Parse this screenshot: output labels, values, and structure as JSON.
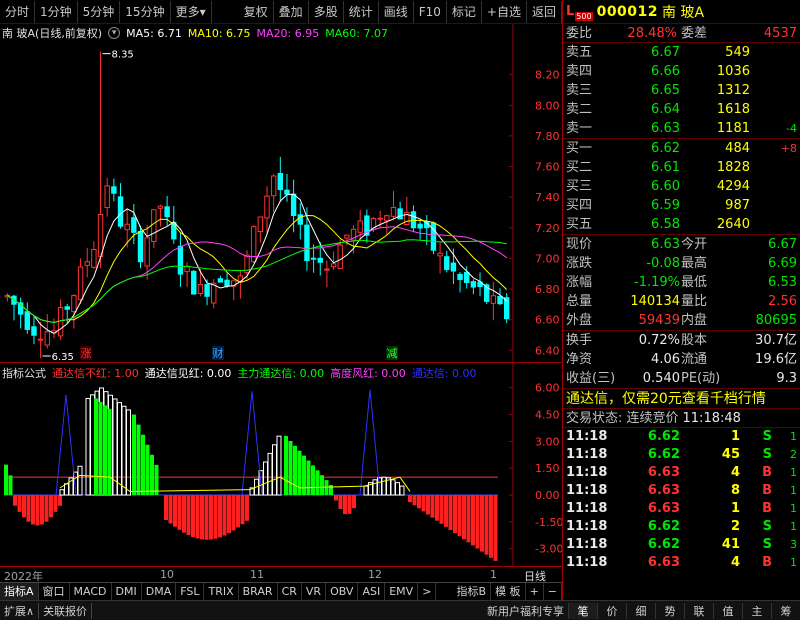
{
  "toolbar": {
    "left": [
      "分时",
      "1分钟",
      "5分钟",
      "15分钟",
      "更多▾"
    ],
    "right": [
      "复权",
      "叠加",
      "多股",
      "统计",
      "画线",
      "F10",
      "标记",
      "+自选",
      "返回"
    ]
  },
  "legend": {
    "stock": "南 玻A(日线,前复权)",
    "ma5": "MA5: 6.71",
    "ma10": "MA10: 6.75",
    "ma20": "MA20: 6.95",
    "ma60": "MA60: 7.07"
  },
  "main_chart": {
    "y_ticks": [
      "8.20",
      "8.00",
      "7.80",
      "7.60",
      "7.40",
      "7.20",
      "7.00",
      "6.80",
      "6.60",
      "6.40"
    ],
    "y_values": [
      8.2,
      8.0,
      7.8,
      7.6,
      7.4,
      7.2,
      7.0,
      6.8,
      6.6,
      6.4
    ],
    "high_label": "8.35",
    "low_label": "6.35",
    "high_value": 8.35,
    "low_value": 6.35,
    "ylim": [
      6.35,
      8.4
    ],
    "markers": [
      {
        "text": "涨",
        "color": "#ff3030",
        "bg": "#400000"
      },
      {
        "text": "财",
        "color": "#40a0ff",
        "bg": "#002040"
      },
      {
        "text": "减",
        "color": "#30ff30",
        "bg": "#003000"
      }
    ],
    "colors": {
      "up": "#ff3232",
      "down": "#00ffff",
      "ma5": "#ffffff",
      "ma10": "#ffff00",
      "ma20": "#ff40ff",
      "ma60": "#00ff00"
    }
  },
  "indicator": {
    "title": "指标公式",
    "items": [
      {
        "text": "通达信不红: 1.00",
        "color": "#ff3232"
      },
      {
        "text": "通达信见红: 0.00",
        "color": "#ffffff"
      },
      {
        "text": "主力通达信: 0.00",
        "color": "#00ff00"
      },
      {
        "text": "高度风红: 0.00",
        "color": "#ff40ff"
      },
      {
        "text": "通达信: 0.00",
        "color": "#3030ff"
      }
    ],
    "y_ticks": [
      "6.00",
      "4.50",
      "3.00",
      "1.50",
      "0.00",
      "-1.50",
      "-3.00"
    ],
    "y_values": [
      6.0,
      4.5,
      3.0,
      1.5,
      0.0,
      -1.5,
      -3.0
    ],
    "ylim": [
      -3.8,
      6.6
    ]
  },
  "xaxis": {
    "labels": [
      "2022年",
      "10",
      "11",
      "12",
      "1"
    ],
    "right_label": "日线"
  },
  "tabs": [
    "指标A",
    "窗口",
    "MACD",
    "DMI",
    "DMA",
    "FSL",
    "TRIX",
    "BRAR",
    "CR",
    "VR",
    "OBV",
    "ASI",
    "EMV",
    ">",
    "指标B",
    "模 板",
    "+",
    "−"
  ],
  "status": {
    "left": [
      "扩展∧",
      "关联报价"
    ],
    "promo_link": "新用户福利专享",
    "right_tabs": [
      "笔",
      "价",
      "细",
      "势",
      "联",
      "值",
      "主",
      "筹"
    ]
  },
  "quote_header": {
    "market": "L",
    "market_sub": "500",
    "code": "000012",
    "name": "南 玻A"
  },
  "weibi": {
    "label": "委比",
    "value": "28.48%",
    "label2": "委差",
    "value2": "4537"
  },
  "asks": [
    {
      "label": "卖五",
      "price": "6.67",
      "vol": "549",
      "chg": ""
    },
    {
      "label": "卖四",
      "price": "6.66",
      "vol": "1036",
      "chg": ""
    },
    {
      "label": "卖三",
      "price": "6.65",
      "vol": "1312",
      "chg": ""
    },
    {
      "label": "卖二",
      "price": "6.64",
      "vol": "1618",
      "chg": ""
    },
    {
      "label": "卖一",
      "price": "6.63",
      "vol": "1181",
      "chg": "-4"
    }
  ],
  "bids": [
    {
      "label": "买一",
      "price": "6.62",
      "vol": "484",
      "chg": "+8"
    },
    {
      "label": "买二",
      "price": "6.61",
      "vol": "1828",
      "chg": ""
    },
    {
      "label": "买三",
      "price": "6.60",
      "vol": "4294",
      "chg": ""
    },
    {
      "label": "买四",
      "price": "6.59",
      "vol": "987",
      "chg": ""
    },
    {
      "label": "买五",
      "price": "6.58",
      "vol": "2640",
      "chg": ""
    }
  ],
  "quote": [
    {
      "l1": "现价",
      "v1": "6.63",
      "c1": "green",
      "l2": "今开",
      "v2": "6.67",
      "c2": "green"
    },
    {
      "l1": "涨跌",
      "v1": "-0.08",
      "c1": "green",
      "l2": "最高",
      "v2": "6.69",
      "c2": "green"
    },
    {
      "l1": "涨幅",
      "v1": "-1.19%",
      "c1": "green",
      "l2": "最低",
      "v2": "6.53",
      "c2": "green"
    },
    {
      "l1": "总量",
      "v1": "140134",
      "c1": "yellow",
      "l2": "量比",
      "v2": "2.56",
      "c2": "red"
    },
    {
      "l1": "外盘",
      "v1": "59439",
      "c1": "red",
      "l2": "内盘",
      "v2": "80695",
      "c2": "green"
    }
  ],
  "fund": [
    {
      "l1": "换手",
      "v1": "0.72%",
      "l2": "股本",
      "v2": "30.7亿"
    },
    {
      "l1": "净资",
      "v1": "4.06",
      "l2": "流通",
      "v2": "19.6亿"
    },
    {
      "l1": "收益(三)",
      "v1": "0.540",
      "l2": "PE(动)",
      "v2": "9.3"
    }
  ],
  "promo": "通达信，仅需20元查看千档行情",
  "trade_status": {
    "label": "交易状态: 连续竞价",
    "time": "11:18:48"
  },
  "ticks": [
    {
      "time": "11:18",
      "price": "6.62",
      "vol": "1",
      "side": "S",
      "sc": "green",
      "cnt": "1"
    },
    {
      "time": "11:18",
      "price": "6.62",
      "vol": "45",
      "side": "S",
      "sc": "green",
      "cnt": "2"
    },
    {
      "time": "11:18",
      "price": "6.63",
      "vol": "4",
      "side": "B",
      "sc": "red",
      "cnt": "1"
    },
    {
      "time": "11:18",
      "price": "6.63",
      "vol": "8",
      "side": "B",
      "sc": "red",
      "cnt": "1"
    },
    {
      "time": "11:18",
      "price": "6.63",
      "vol": "1",
      "side": "B",
      "sc": "red",
      "cnt": "1"
    },
    {
      "time": "11:18",
      "price": "6.62",
      "vol": "2",
      "side": "S",
      "sc": "green",
      "cnt": "1"
    },
    {
      "time": "11:18",
      "price": "6.62",
      "vol": "41",
      "side": "S",
      "sc": "green",
      "cnt": "3"
    },
    {
      "time": "11:18",
      "price": "6.63",
      "vol": "4",
      "side": "B",
      "sc": "red",
      "cnt": "1"
    }
  ]
}
